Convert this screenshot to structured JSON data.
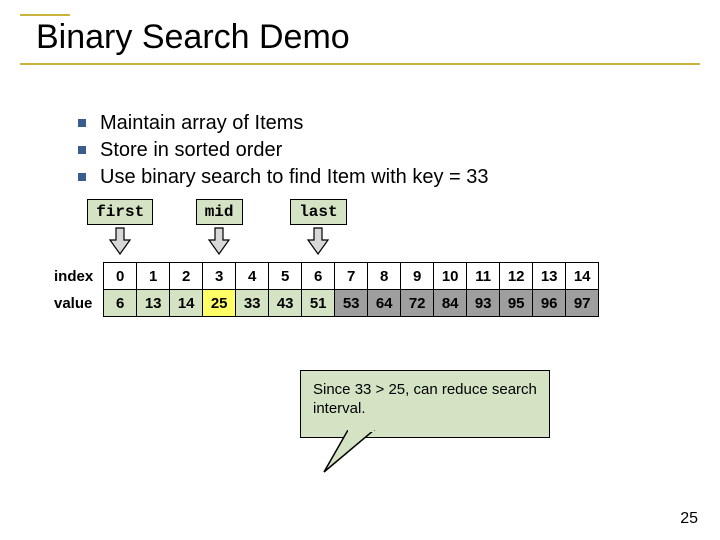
{
  "title": "Binary Search Demo",
  "bullets": [
    "Maintain array of Items",
    "Store in sorted order",
    "Use binary search to find Item with key = 33"
  ],
  "pointers": {
    "first": {
      "label": "first",
      "col": 0
    },
    "mid": {
      "label": "mid",
      "col": 3
    },
    "last": {
      "label": "last",
      "col": 6
    }
  },
  "table": {
    "row_headers": {
      "index": "index",
      "value": "value"
    },
    "indices": [
      "0",
      "1",
      "2",
      "3",
      "4",
      "5",
      "6",
      "7",
      "8",
      "9",
      "10",
      "11",
      "12",
      "13",
      "14"
    ],
    "values": [
      "6",
      "13",
      "14",
      "25",
      "33",
      "43",
      "51",
      "53",
      "64",
      "72",
      "84",
      "93",
      "95",
      "96",
      "97"
    ],
    "highlight_range": {
      "from": 0,
      "to": 6,
      "type": "active"
    },
    "gray_from": 7,
    "yellow_col": 3
  },
  "callout": "Since 33 > 25, can reduce search interval.",
  "page_number": "25"
}
